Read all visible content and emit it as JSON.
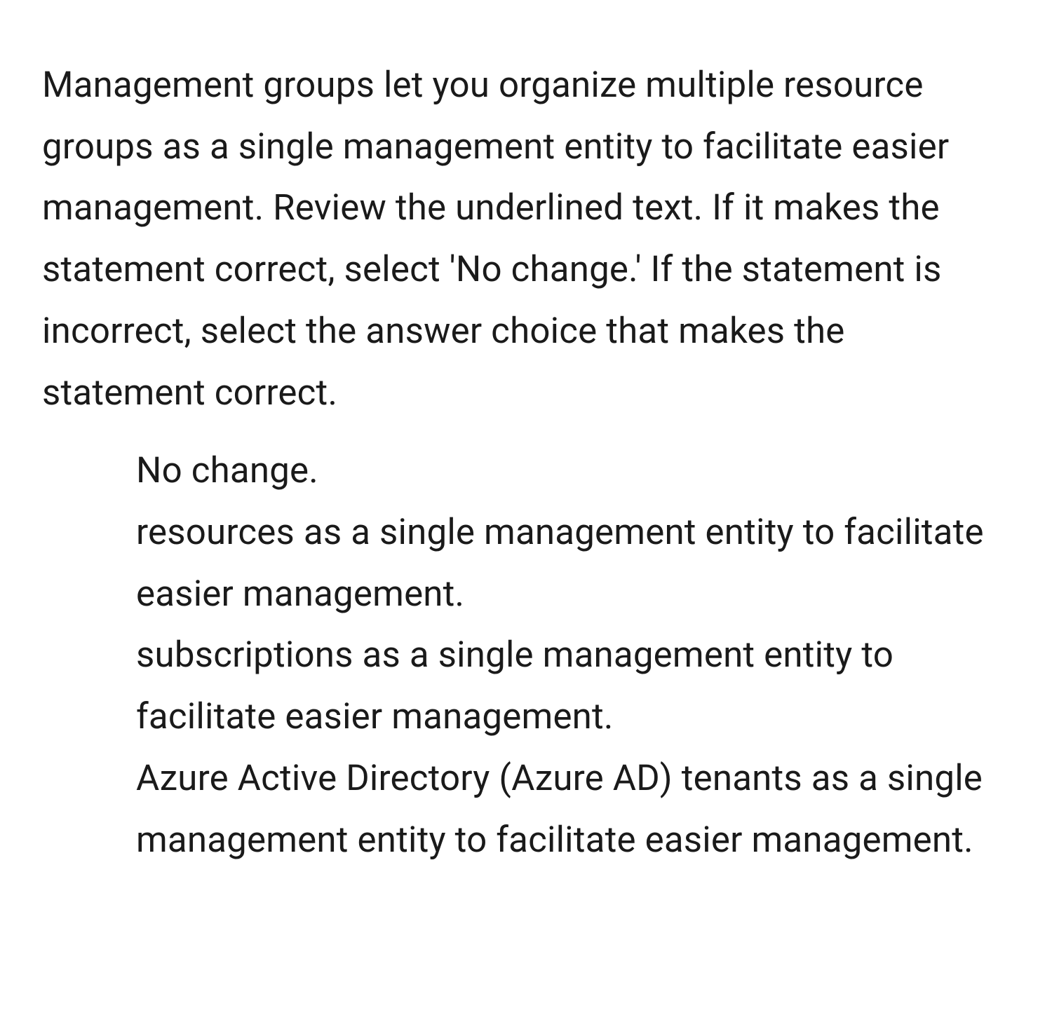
{
  "question": "Management groups let you organize multiple resource groups as a single management entity to facilitate easier management. Review the underlined text. If it makes the statement correct, select 'No change.' If the statement is incorrect, select the answer choice that makes the statement correct.",
  "options": [
    "No change.",
    "resources as a single management entity to facilitate easier management.",
    "subscriptions as a single management entity to facilitate easier management.",
    "Azure Active Directory (Azure AD) tenants as a single management entity to facilitate easier management."
  ]
}
